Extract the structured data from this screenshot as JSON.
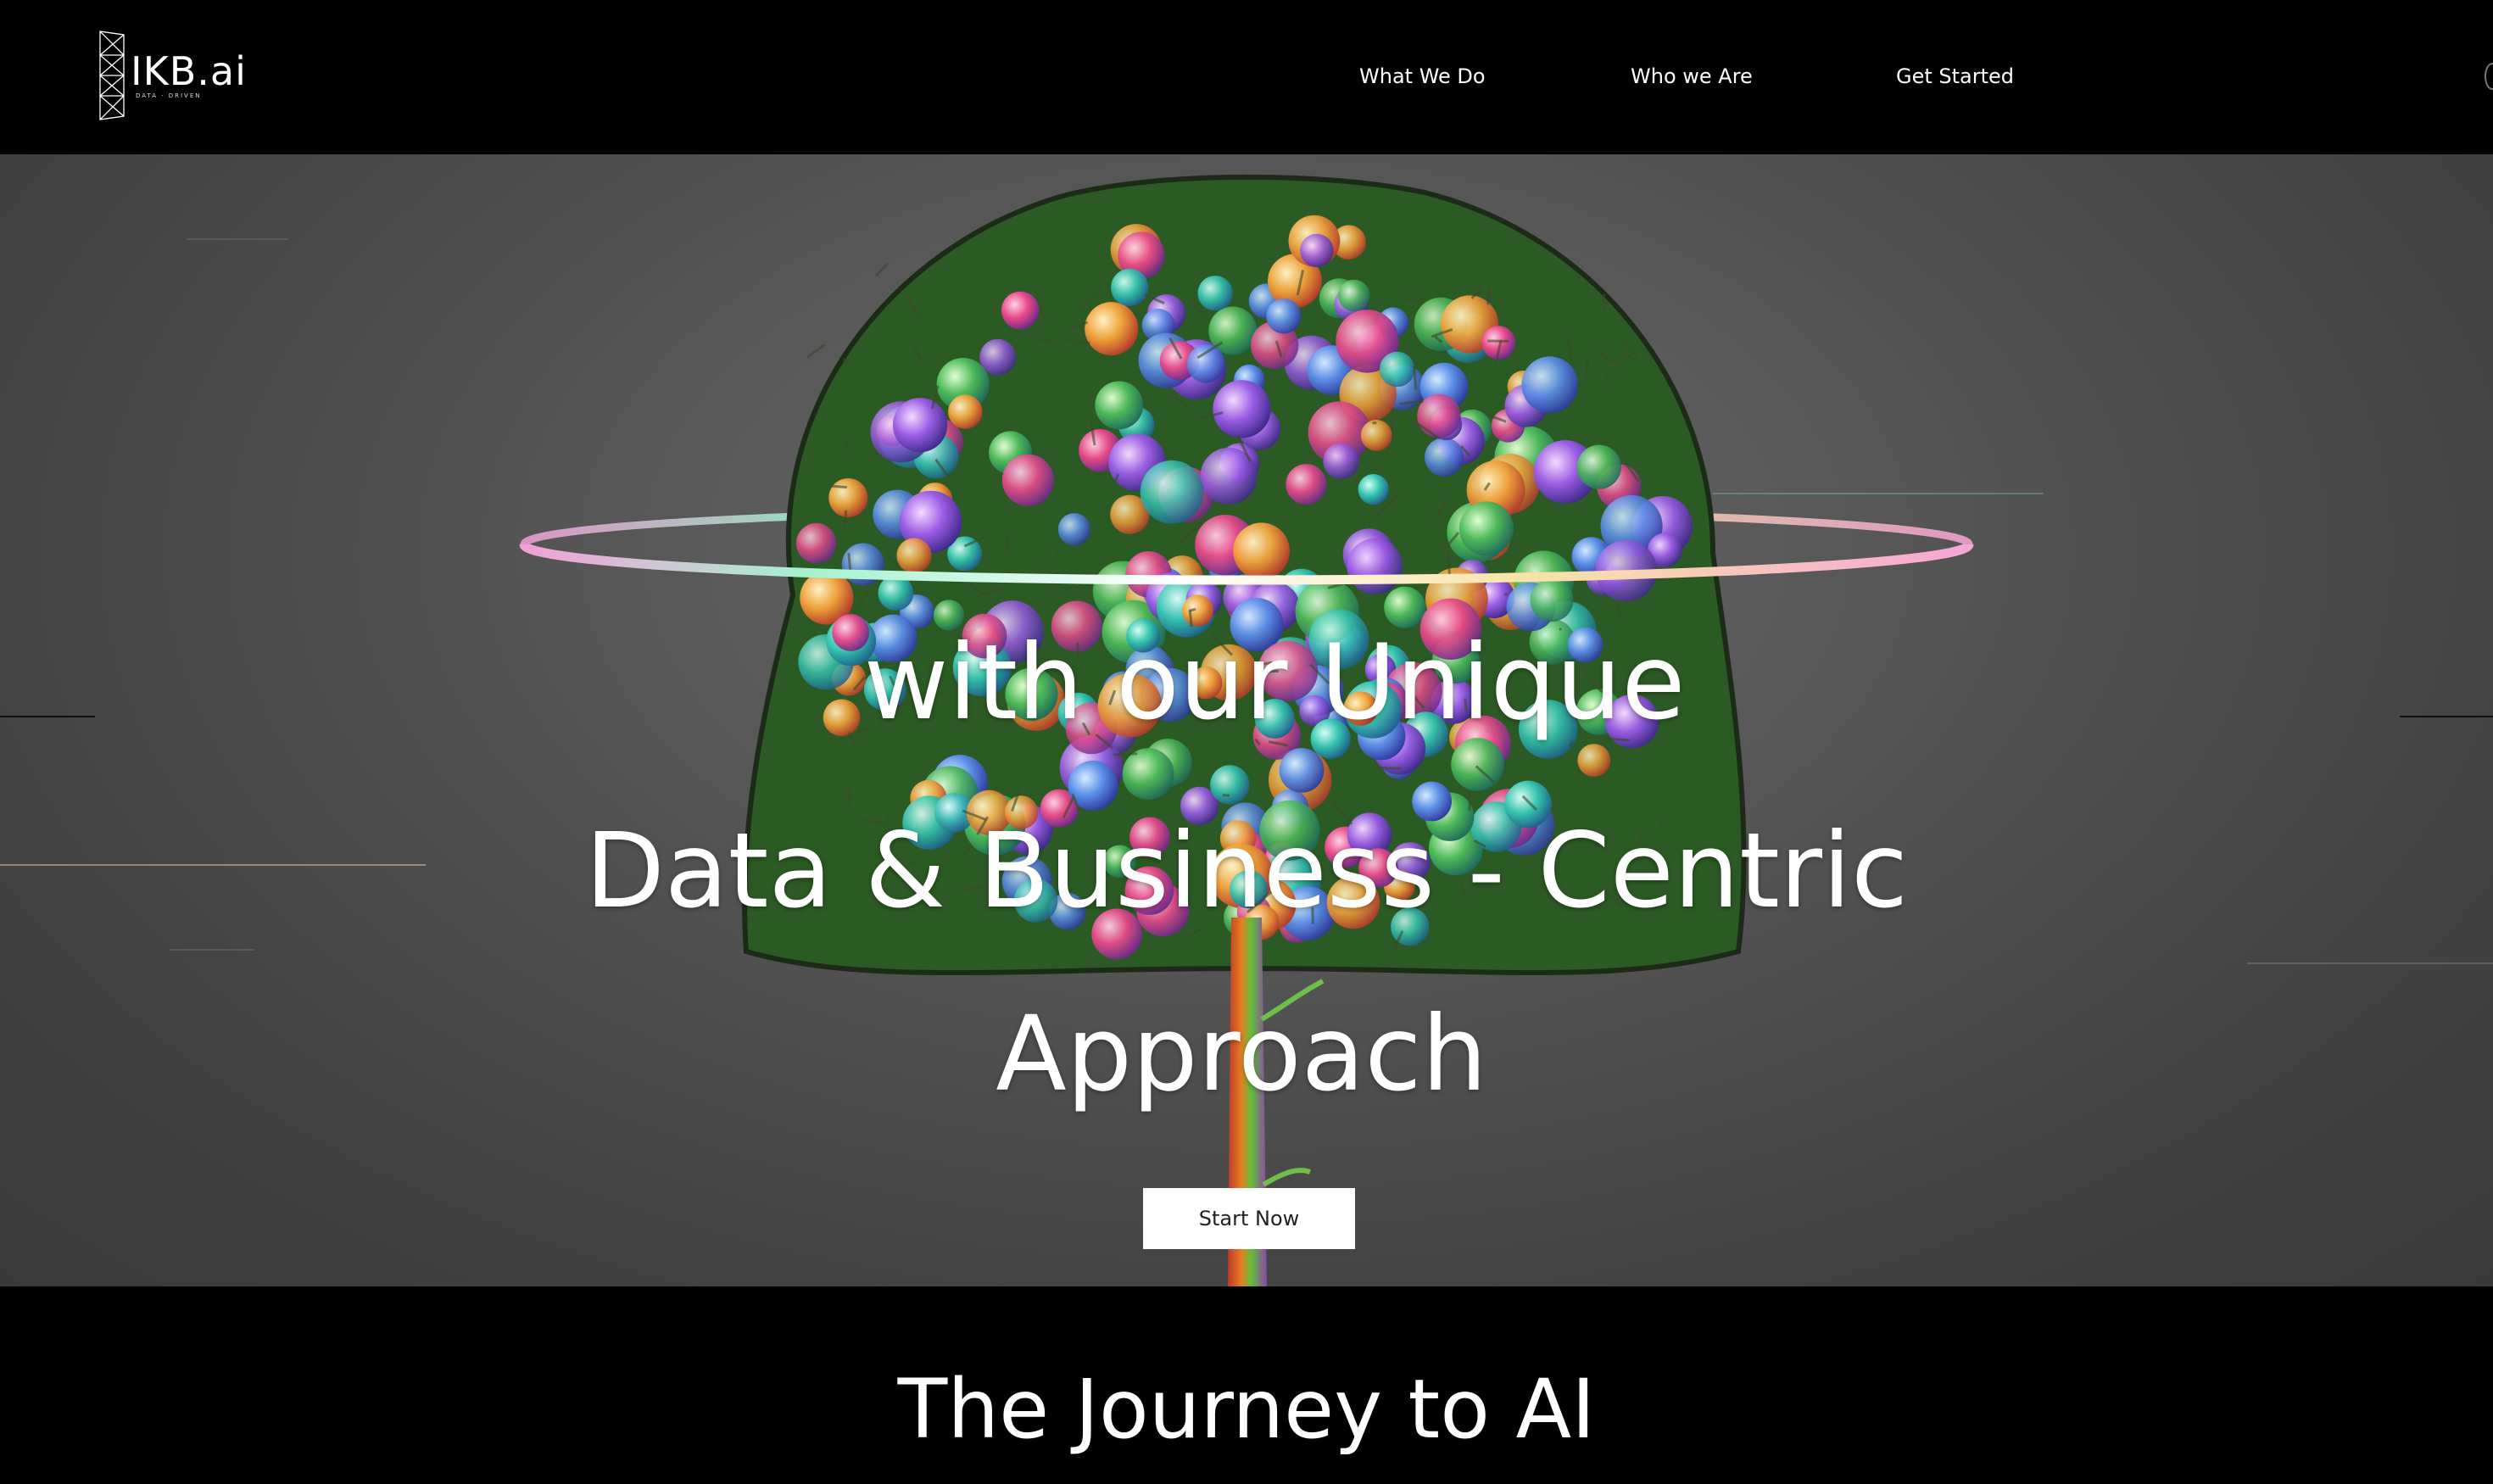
{
  "header": {
    "logo_text": "IKB.ai",
    "logo_tagline": "DATA · DRIVEN",
    "nav": [
      {
        "label": "What We Do"
      },
      {
        "label": "Who we Are"
      },
      {
        "label": "Get Started"
      }
    ]
  },
  "hero": {
    "headline_line1": "with our Unique",
    "headline_line2": "Data & Business - Centric",
    "headline_line3": "Approach",
    "cta_label": "Start Now",
    "background_color": "#575757"
  },
  "journey": {
    "title": "The Journey to AI"
  },
  "colors": {
    "header_bg": "#000000",
    "text": "#ffffff",
    "button_bg": "#ffffff",
    "button_text": "#222222"
  }
}
